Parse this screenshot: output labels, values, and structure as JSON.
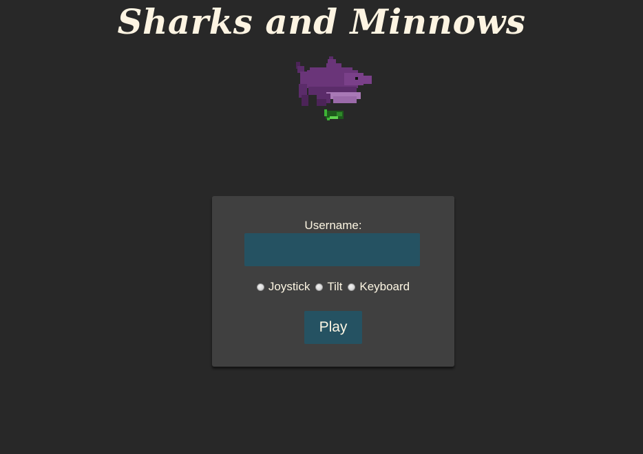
{
  "header": {
    "title": "Sharks and Minnows"
  },
  "form": {
    "username_label": "Username:",
    "username_value": "",
    "username_placeholder": "",
    "control_options": [
      {
        "label": "Joystick",
        "selected": false
      },
      {
        "label": "Tilt",
        "selected": false
      },
      {
        "label": "Keyboard",
        "selected": false
      }
    ],
    "play_label": "Play"
  },
  "colors": {
    "background": "#282828",
    "panel": "#404040",
    "accent": "#255262",
    "text": "#fdf6e3",
    "shark": "#6a3579",
    "minnow": "#2f8a2a"
  },
  "icons": {
    "mascot": "shark-icon",
    "minnow": "minnow-icon"
  }
}
